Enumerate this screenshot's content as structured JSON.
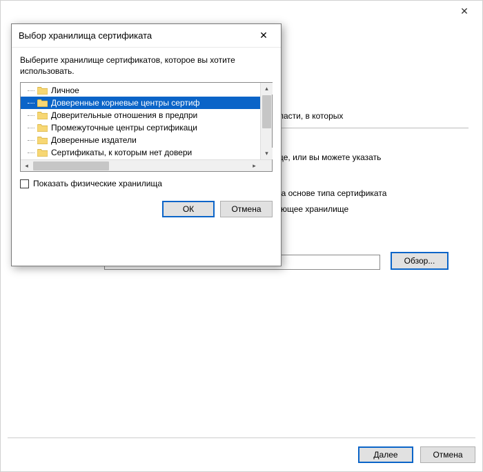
{
  "wizard": {
    "close_tooltip": "Закрыть",
    "text_frag_1": "области, в которых",
    "text_frag_2": "ще, или вы можете указать",
    "text_frag_3": "на основе типа сертификата",
    "text_frag_4": "ующее хранилище",
    "browse_label": "Обзор...",
    "next_label": "Далее",
    "cancel_label": "Отмена"
  },
  "modal": {
    "title": "Выбор хранилища сертификата",
    "instruction": "Выберите хранилище сертификатов, которое вы хотите использовать.",
    "items": [
      {
        "label": "Личное",
        "selected": false
      },
      {
        "label": "Доверенные корневые центры сертиф",
        "selected": true
      },
      {
        "label": "Доверительные отношения в предпри",
        "selected": false
      },
      {
        "label": "Промежуточные центры сертификаци",
        "selected": false
      },
      {
        "label": "Доверенные издатели",
        "selected": false
      },
      {
        "label": "Сертификаты, к которым нет довери",
        "selected": false
      }
    ],
    "show_physical_label": "Показать физические хранилища",
    "ok_label": "ОК",
    "cancel_label": "Отмена"
  }
}
